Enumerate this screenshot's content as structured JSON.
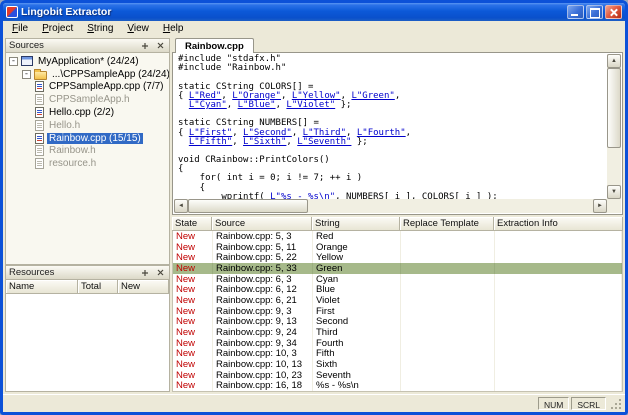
{
  "window": {
    "title": "Lingobit Extractor"
  },
  "menu": {
    "items": [
      {
        "label": "File"
      },
      {
        "label": "Project"
      },
      {
        "label": "String"
      },
      {
        "label": "View"
      },
      {
        "label": "Help"
      }
    ]
  },
  "icons": {
    "scroll_up": "▲",
    "scroll_down": "▼",
    "scroll_left": "◄",
    "scroll_right": "►"
  },
  "sources_panel": {
    "title": "Sources",
    "tree": [
      {
        "label": "MyApplication* (24/24)",
        "level": 0,
        "icon": "app",
        "expander": true
      },
      {
        "label": "...\\CPPSampleApp (24/24)",
        "level": 1,
        "icon": "folder",
        "expander": true
      },
      {
        "label": "CPPSampleApp.cpp (7/7)",
        "level": 2,
        "icon": "cpp"
      },
      {
        "label": "CPPSampleApp.h",
        "level": 2,
        "icon": "header",
        "dim": true
      },
      {
        "label": "Hello.cpp (2/2)",
        "level": 2,
        "icon": "cpp"
      },
      {
        "label": "Hello.h",
        "level": 2,
        "icon": "header",
        "dim": true
      },
      {
        "label": "Rainbow.cpp (15/15)",
        "level": 2,
        "icon": "cpp",
        "selected": true
      },
      {
        "label": "Rainbow.h",
        "level": 2,
        "icon": "header",
        "dim": true
      },
      {
        "label": "resource.h",
        "level": 2,
        "icon": "header",
        "dim": true
      }
    ]
  },
  "resources_panel": {
    "title": "Resources",
    "columns": [
      "Name",
      "Total",
      "New"
    ]
  },
  "editor": {
    "tab": "Rainbow.cpp",
    "lines": [
      {
        "segs": [
          {
            "text": "#include \"stdafx.h\""
          }
        ]
      },
      {
        "segs": [
          {
            "text": "#include \"Rainbow.h\""
          }
        ]
      },
      {
        "segs": []
      },
      {
        "segs": [
          {
            "text": "static CString COLORS[] ="
          }
        ]
      },
      {
        "segs": [
          {
            "text": "{ "
          },
          {
            "text": "L\"Red\"",
            "link": true
          },
          {
            "text": ", "
          },
          {
            "text": "L\"Orange\"",
            "link": true
          },
          {
            "text": ", "
          },
          {
            "text": "L\"Yellow\"",
            "link": true
          },
          {
            "text": ", "
          },
          {
            "text": "L\"Green\"",
            "link": true
          },
          {
            "text": ","
          }
        ]
      },
      {
        "segs": [
          {
            "text": "  "
          },
          {
            "text": "L\"Cyan\"",
            "link": true
          },
          {
            "text": ", "
          },
          {
            "text": "L\"Blue\"",
            "link": true
          },
          {
            "text": ", "
          },
          {
            "text": "L\"Violet\"",
            "link": true
          },
          {
            "text": " };"
          }
        ]
      },
      {
        "segs": []
      },
      {
        "segs": [
          {
            "text": "static CString NUMBERS[] ="
          }
        ]
      },
      {
        "segs": [
          {
            "text": "{ "
          },
          {
            "text": "L\"First\"",
            "link": true
          },
          {
            "text": ", "
          },
          {
            "text": "L\"Second\"",
            "link": true
          },
          {
            "text": ", "
          },
          {
            "text": "L\"Third\"",
            "link": true
          },
          {
            "text": ", "
          },
          {
            "text": "L\"Fourth\"",
            "link": true
          },
          {
            "text": ","
          }
        ]
      },
      {
        "segs": [
          {
            "text": "  "
          },
          {
            "text": "L\"Fifth\"",
            "link": true
          },
          {
            "text": ", "
          },
          {
            "text": "L\"Sixth\"",
            "link": true
          },
          {
            "text": ", "
          },
          {
            "text": "L\"Seventh\"",
            "link": true
          },
          {
            "text": " };"
          }
        ]
      },
      {
        "segs": []
      },
      {
        "segs": [
          {
            "text": "void CRainbow::PrintColors()"
          }
        ]
      },
      {
        "segs": [
          {
            "text": "{"
          }
        ]
      },
      {
        "segs": [
          {
            "text": "    for( int i = 0; i != 7; ++ i )"
          }
        ]
      },
      {
        "segs": [
          {
            "text": "    {"
          }
        ]
      },
      {
        "segs": [
          {
            "text": "        wprintf( "
          },
          {
            "text": "L\"%s - %s\\n\"",
            "link": true
          },
          {
            "text": ", NUMBERS[ i ], COLORS[ i ] );"
          }
        ]
      }
    ]
  },
  "strings_table": {
    "columns": [
      "State",
      "Source",
      "String",
      "Replace Template",
      "Extraction Info"
    ],
    "selected_index": 3,
    "rows": [
      {
        "state": "New",
        "source": "Rainbow.cpp: 5, 3",
        "string": "Red"
      },
      {
        "state": "New",
        "source": "Rainbow.cpp: 5, 11",
        "string": "Orange"
      },
      {
        "state": "New",
        "source": "Rainbow.cpp: 5, 22",
        "string": "Yellow"
      },
      {
        "state": "New",
        "source": "Rainbow.cpp: 5, 33",
        "string": "Green"
      },
      {
        "state": "New",
        "source": "Rainbow.cpp: 6, 3",
        "string": "Cyan"
      },
      {
        "state": "New",
        "source": "Rainbow.cpp: 6, 12",
        "string": "Blue"
      },
      {
        "state": "New",
        "source": "Rainbow.cpp: 6, 21",
        "string": "Violet"
      },
      {
        "state": "New",
        "source": "Rainbow.cpp: 9, 3",
        "string": "First"
      },
      {
        "state": "New",
        "source": "Rainbow.cpp: 9, 13",
        "string": "Second"
      },
      {
        "state": "New",
        "source": "Rainbow.cpp: 9, 24",
        "string": "Third"
      },
      {
        "state": "New",
        "source": "Rainbow.cpp: 9, 34",
        "string": "Fourth"
      },
      {
        "state": "New",
        "source": "Rainbow.cpp: 10, 3",
        "string": "Fifth"
      },
      {
        "state": "New",
        "source": "Rainbow.cpp: 10, 13",
        "string": "Sixth"
      },
      {
        "state": "New",
        "source": "Rainbow.cpp: 10, 23",
        "string": "Seventh"
      },
      {
        "state": "New",
        "source": "Rainbow.cpp: 16, 18",
        "string": "%s - %s\\n"
      }
    ]
  },
  "status_bar": {
    "indicators": [
      "NUM",
      "SCRL"
    ]
  },
  "colors": {
    "titlebar_blue": "#0c51d8",
    "window_face": "#ece9d8",
    "selection_blue": "#316ac5",
    "selection_green": "#a6b98a",
    "state_new_red": "#c00000",
    "string_link_blue": "#0000cc"
  }
}
